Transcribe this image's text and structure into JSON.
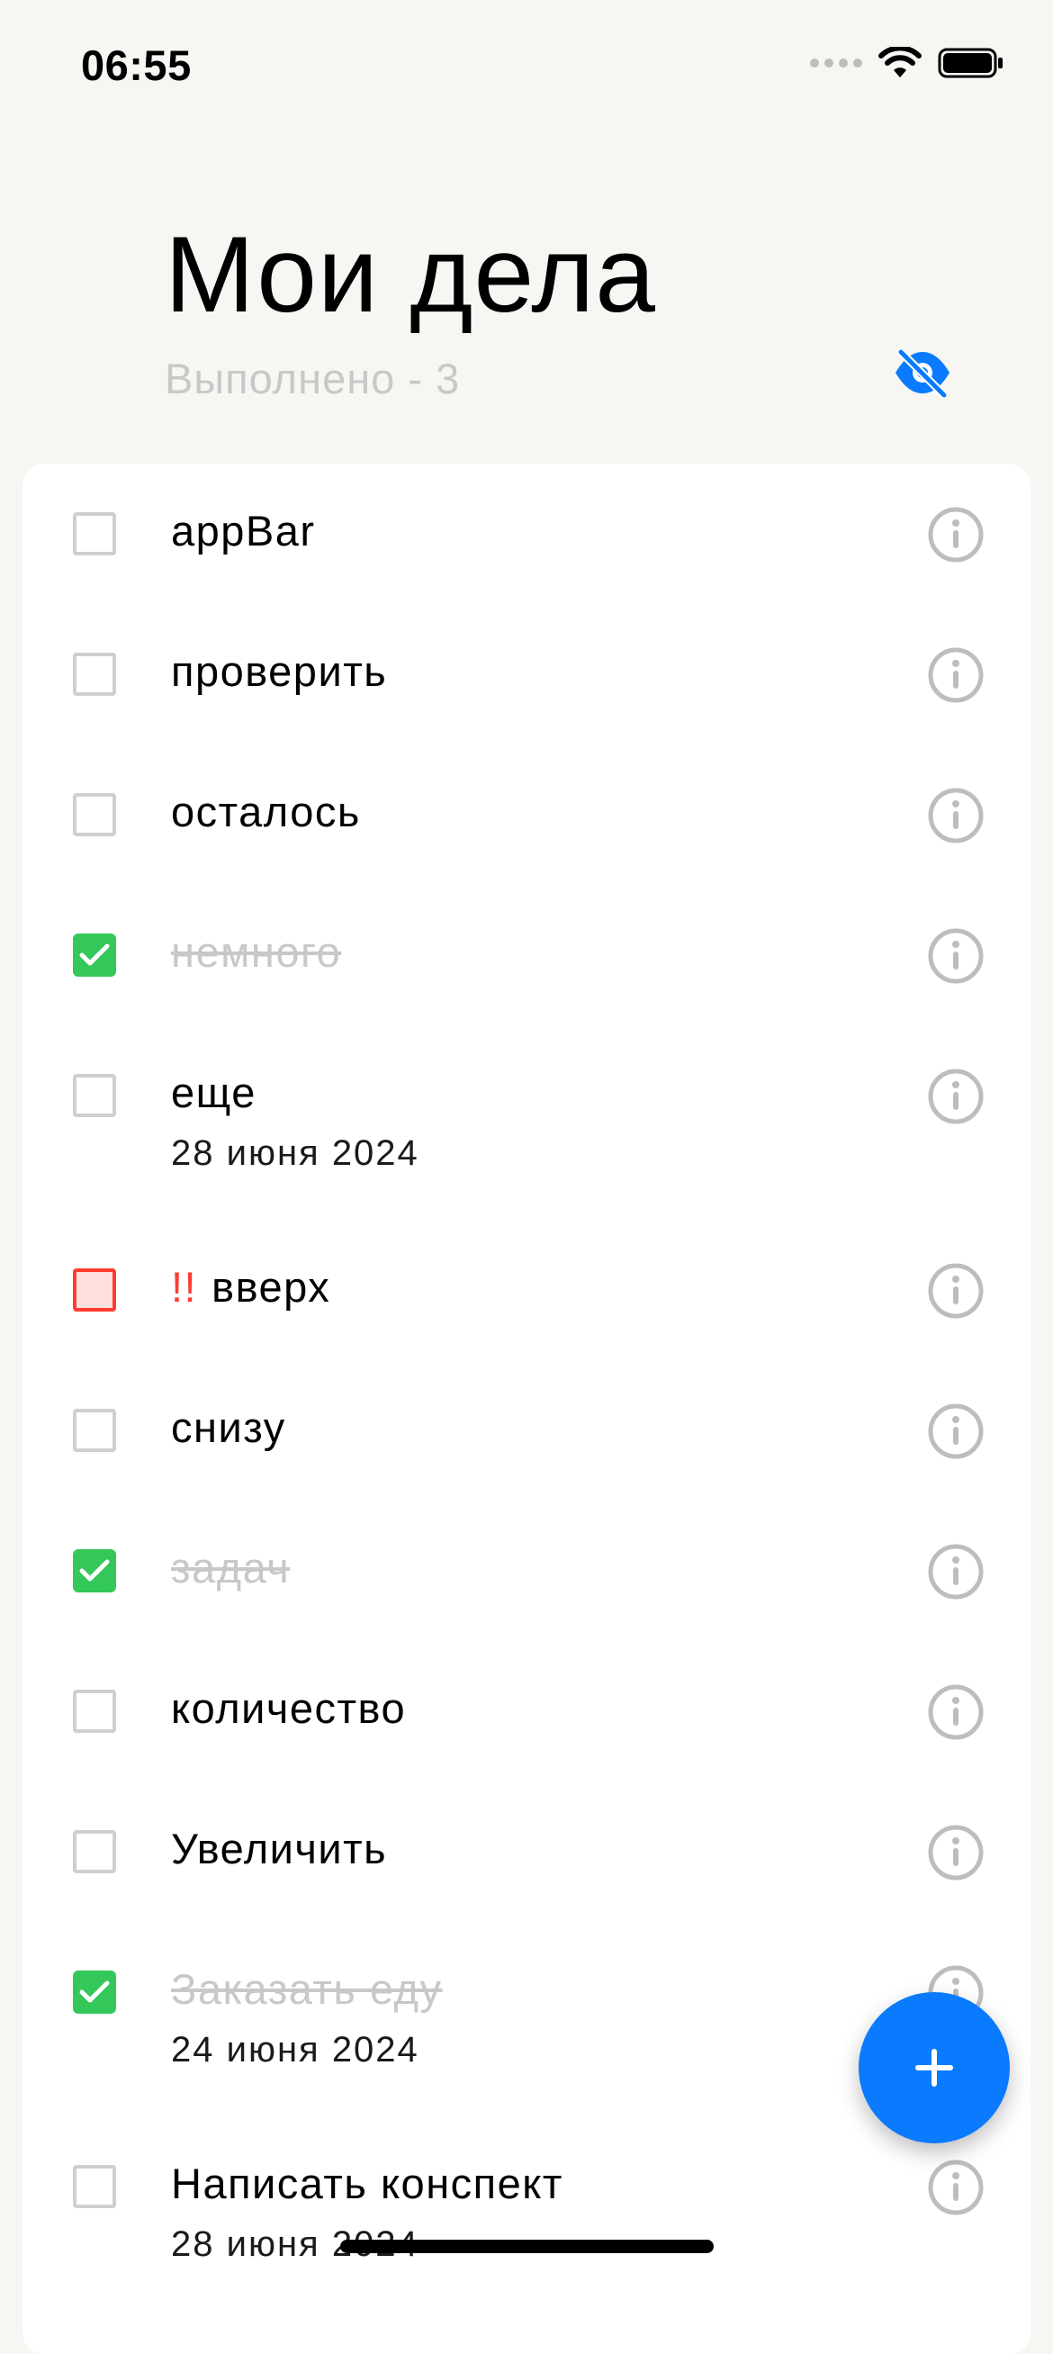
{
  "status_bar": {
    "time": "06:55",
    "icons": [
      "signal-icon",
      "wifi-icon",
      "battery-icon"
    ]
  },
  "header": {
    "title": "Мои дела",
    "subtitle": "Выполнено - 3",
    "visibility_icon": "eye-slash-icon"
  },
  "colors": {
    "background": "#F7F6F2",
    "accent": "#0A7AFF",
    "done_check": "#34C759",
    "high_priority": "#FF3B30",
    "muted_text": "#C8C8C8"
  },
  "tasks": [
    {
      "text": "appBar",
      "done": false,
      "priority": "none",
      "date": ""
    },
    {
      "text": "проверить",
      "done": false,
      "priority": "none",
      "date": ""
    },
    {
      "text": "осталось",
      "done": false,
      "priority": "none",
      "date": ""
    },
    {
      "text": "немного",
      "done": true,
      "priority": "none",
      "date": ""
    },
    {
      "text": "еще",
      "done": false,
      "priority": "none",
      "date": "28 июня 2024"
    },
    {
      "text": "вверх",
      "done": false,
      "priority": "high",
      "priority_mark": "!!",
      "date": ""
    },
    {
      "text": "снизу",
      "done": false,
      "priority": "none",
      "date": ""
    },
    {
      "text": "задач",
      "done": true,
      "priority": "none",
      "date": ""
    },
    {
      "text": "количество",
      "done": false,
      "priority": "none",
      "date": ""
    },
    {
      "text": "Увеличить",
      "done": false,
      "priority": "none",
      "date": ""
    },
    {
      "text": "Заказать еду",
      "done": true,
      "priority": "none",
      "date": "24 июня 2024"
    },
    {
      "text": "Написать конспект",
      "done": false,
      "priority": "none",
      "date": "28 июня 2024"
    }
  ],
  "fab": {
    "icon": "plus-icon"
  }
}
